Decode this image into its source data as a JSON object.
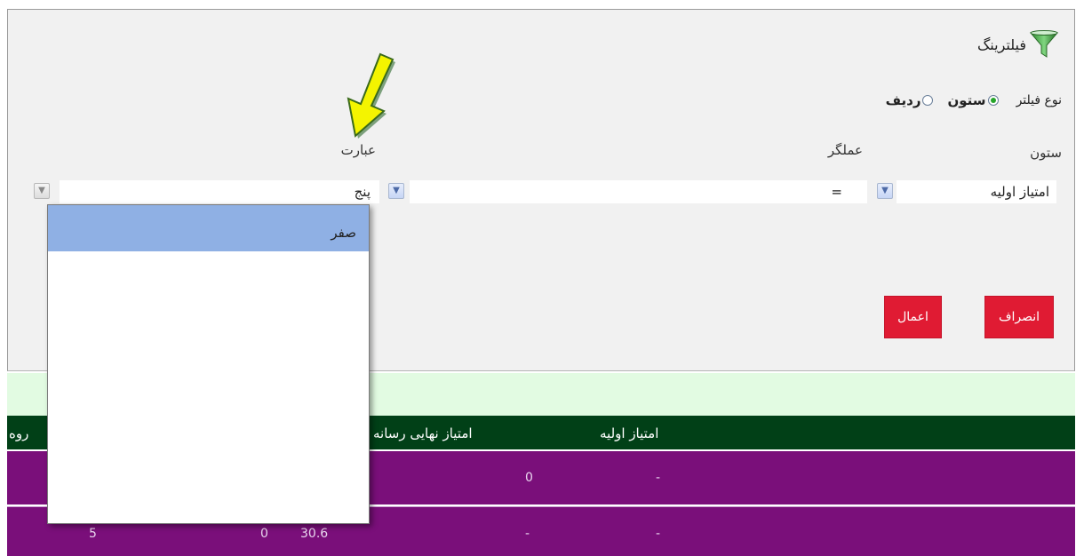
{
  "filter": {
    "title": "فیلترینگ",
    "filter_type_label": "نوع فیلتر",
    "option_column": "ستون",
    "option_row": "ردیف",
    "column_label": "ستون",
    "operator_label": "عملگر",
    "expression_label": "عبارت",
    "column_value": "امتیاز اولیه",
    "operator_value": "=",
    "expression_value": "پنج",
    "cancel_label": "انصراف",
    "apply_label": "اعمال"
  },
  "dropdown": {
    "items": [
      "صفر"
    ]
  },
  "table": {
    "headers": [
      "امتیاز اولیه",
      "امتیاز نهایی رسانه",
      "روه"
    ],
    "rows": [
      {
        "cells": [
          "-",
          "0"
        ]
      },
      {
        "cells": [
          "-",
          "-",
          "30.6",
          "0",
          "5"
        ]
      }
    ]
  },
  "colors": {
    "accent_button": "#e01b33",
    "header_bg": "#014017",
    "row_bg": "#7a0f7a",
    "selected_item": "#8fb0e4",
    "pointer_arrow": "#f4f400"
  },
  "icons": {
    "title_icon": "funnel-icon",
    "pointer": "yellow-arrow-icon"
  }
}
